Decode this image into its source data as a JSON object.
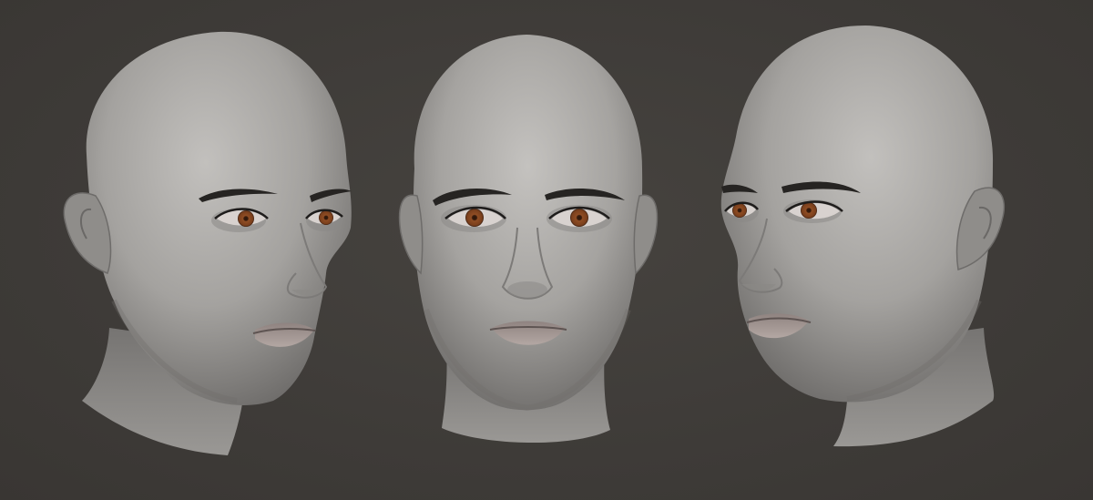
{
  "scene": {
    "background_color": "#3f3c3a",
    "skin_color": "#a7a5a2",
    "iris_color": "#8a4a22",
    "lip_color": "#a39490",
    "brow_color": "#262422"
  },
  "views": [
    {
      "name": "three-quarter-right",
      "facing": "right"
    },
    {
      "name": "front",
      "facing": "front"
    },
    {
      "name": "three-quarter-left",
      "facing": "left"
    }
  ]
}
